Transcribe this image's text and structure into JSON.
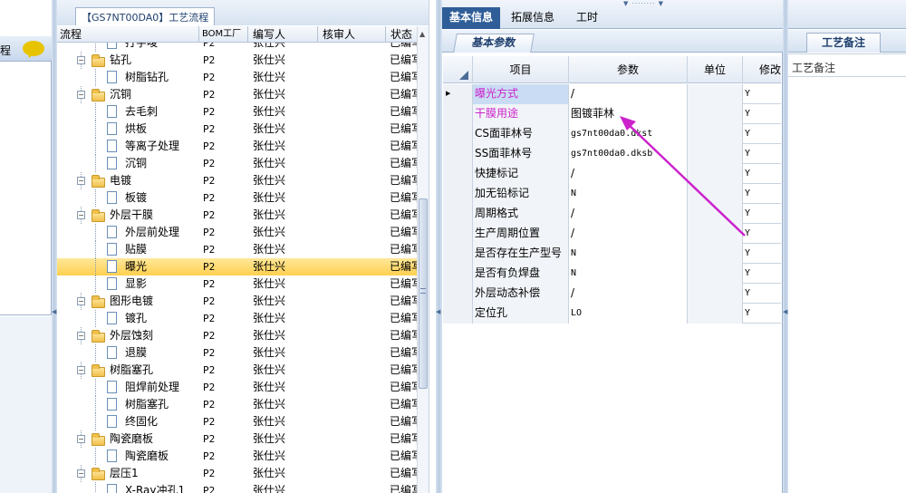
{
  "colors": {
    "accent": "#2f5d98",
    "highlight_row": "#ffd860",
    "tab_active": "#2f5d98",
    "magenta": "#cc22cc"
  },
  "left_panel": {
    "label": "程"
  },
  "process": {
    "title": "【GS7NT00DA0】工艺流程",
    "columns": [
      "流程",
      "BOM工厂",
      "编写人",
      "核审人",
      "状态"
    ],
    "rows": [
      {
        "name": "打字唛",
        "level": 2,
        "type": "doc",
        "bom": "P2",
        "writer": "张仕兴",
        "reviewer": "",
        "status": "已编写"
      },
      {
        "name": "钻孔",
        "level": 1,
        "type": "folder",
        "bom": "P2",
        "writer": "张仕兴",
        "reviewer": "",
        "status": "已编写"
      },
      {
        "name": "树脂钻孔",
        "level": 2,
        "type": "doc",
        "bom": "P2",
        "writer": "张仕兴",
        "reviewer": "",
        "status": "已编写"
      },
      {
        "name": "沉铜",
        "level": 1,
        "type": "folder",
        "bom": "P2",
        "writer": "张仕兴",
        "reviewer": "",
        "status": "已编写"
      },
      {
        "name": "去毛刺",
        "level": 2,
        "type": "doc",
        "bom": "P2",
        "writer": "张仕兴",
        "reviewer": "",
        "status": "已编写"
      },
      {
        "name": "烘板",
        "level": 2,
        "type": "doc",
        "bom": "P2",
        "writer": "张仕兴",
        "reviewer": "",
        "status": "已编写"
      },
      {
        "name": "等离子处理",
        "level": 2,
        "type": "doc",
        "bom": "P2",
        "writer": "张仕兴",
        "reviewer": "",
        "status": "已编写"
      },
      {
        "name": "沉铜",
        "level": 2,
        "type": "doc",
        "bom": "P2",
        "writer": "张仕兴",
        "reviewer": "",
        "status": "已编写"
      },
      {
        "name": "电镀",
        "level": 1,
        "type": "folder",
        "bom": "P2",
        "writer": "张仕兴",
        "reviewer": "",
        "status": "已编写"
      },
      {
        "name": "板镀",
        "level": 2,
        "type": "doc",
        "bom": "P2",
        "writer": "张仕兴",
        "reviewer": "",
        "status": "已编写"
      },
      {
        "name": "外层干膜",
        "level": 1,
        "type": "folder",
        "bom": "P2",
        "writer": "张仕兴",
        "reviewer": "",
        "status": "已编写"
      },
      {
        "name": "外层前处理",
        "level": 2,
        "type": "doc",
        "bom": "P2",
        "writer": "张仕兴",
        "reviewer": "",
        "status": "已编写"
      },
      {
        "name": "贴膜",
        "level": 2,
        "type": "doc",
        "bom": "P2",
        "writer": "张仕兴",
        "reviewer": "",
        "status": "已编写"
      },
      {
        "name": "曝光",
        "level": 2,
        "type": "doc",
        "bom": "P2",
        "writer": "张仕兴",
        "reviewer": "",
        "status": "已编写",
        "selected": true
      },
      {
        "name": "显影",
        "level": 2,
        "type": "doc",
        "bom": "P2",
        "writer": "张仕兴",
        "reviewer": "",
        "status": "已编写"
      },
      {
        "name": "图形电镀",
        "level": 1,
        "type": "folder",
        "bom": "P2",
        "writer": "张仕兴",
        "reviewer": "",
        "status": "已编写"
      },
      {
        "name": "镀孔",
        "level": 2,
        "type": "doc",
        "bom": "P2",
        "writer": "张仕兴",
        "reviewer": "",
        "status": "已编写"
      },
      {
        "name": "外层蚀刻",
        "level": 1,
        "type": "folder",
        "bom": "P2",
        "writer": "张仕兴",
        "reviewer": "",
        "status": "已编写"
      },
      {
        "name": "退膜",
        "level": 2,
        "type": "doc",
        "bom": "P2",
        "writer": "张仕兴",
        "reviewer": "",
        "status": "已编写"
      },
      {
        "name": "树脂塞孔",
        "level": 1,
        "type": "folder",
        "bom": "P2",
        "writer": "张仕兴",
        "reviewer": "",
        "status": "已编写"
      },
      {
        "name": "阻焊前处理",
        "level": 2,
        "type": "doc",
        "bom": "P2",
        "writer": "张仕兴",
        "reviewer": "",
        "status": "已编写"
      },
      {
        "name": "树脂塞孔",
        "level": 2,
        "type": "doc",
        "bom": "P2",
        "writer": "张仕兴",
        "reviewer": "",
        "status": "已编写"
      },
      {
        "name": "终固化",
        "level": 2,
        "type": "doc",
        "bom": "P2",
        "writer": "张仕兴",
        "reviewer": "",
        "status": "已编写"
      },
      {
        "name": "陶瓷磨板",
        "level": 1,
        "type": "folder",
        "bom": "P2",
        "writer": "张仕兴",
        "reviewer": "",
        "status": "已编写"
      },
      {
        "name": "陶瓷磨板",
        "level": 2,
        "type": "doc",
        "bom": "P2",
        "writer": "张仕兴",
        "reviewer": "",
        "status": "已编写"
      },
      {
        "name": "层压1",
        "level": 1,
        "type": "folder",
        "bom": "P2",
        "writer": "张仕兴",
        "reviewer": "",
        "status": "已编写"
      },
      {
        "name": "X-Ray冲孔1",
        "level": 2,
        "type": "doc",
        "bom": "P2",
        "writer": "张仕兴",
        "reviewer": "",
        "status": "已编写"
      }
    ]
  },
  "tabs": [
    {
      "label": "基本信息",
      "active": true
    },
    {
      "label": "拓展信息",
      "active": false
    },
    {
      "label": "工时",
      "active": false
    }
  ],
  "basic_params": {
    "title": "基本参数",
    "columns": [
      "项目",
      "参数",
      "单位",
      "修改"
    ],
    "rows": [
      {
        "item": "曝光方式",
        "param": "/",
        "unit": "",
        "modify": "Y",
        "magenta": true,
        "current": true
      },
      {
        "item": "干膜用途",
        "param": "图镀菲林",
        "unit": "",
        "modify": "Y",
        "magenta": true
      },
      {
        "item": "CS面菲林号",
        "param": "gs7nt00da0.dkst",
        "unit": "",
        "modify": "Y"
      },
      {
        "item": "SS面菲林号",
        "param": "gs7nt00da0.dksb",
        "unit": "",
        "modify": "Y"
      },
      {
        "item": "快捷标记",
        "param": "/",
        "unit": "",
        "modify": "Y"
      },
      {
        "item": "加无铅标记",
        "param": "N",
        "unit": "",
        "modify": "Y"
      },
      {
        "item": "周期格式",
        "param": "/",
        "unit": "",
        "modify": "Y"
      },
      {
        "item": "生产周期位置",
        "param": "/",
        "unit": "",
        "modify": "Y"
      },
      {
        "item": "是否存在生产型号",
        "param": "N",
        "unit": "",
        "modify": "Y"
      },
      {
        "item": "是否有负焊盘",
        "param": "N",
        "unit": "",
        "modify": "Y"
      },
      {
        "item": "外层动态补偿",
        "param": "/",
        "unit": "",
        "modify": "Y"
      },
      {
        "item": "定位孔",
        "param": "LO",
        "unit": "",
        "modify": "Y"
      }
    ]
  },
  "remark": {
    "title": "工艺备注",
    "content_label": "工艺备注"
  }
}
